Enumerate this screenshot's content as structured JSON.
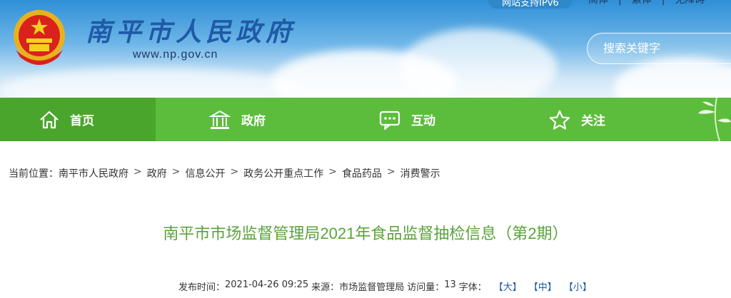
{
  "header": {
    "site_title": "南平市人民政府",
    "site_url": "www.np.gov.cn",
    "ipv6_badge": "网站支持IPv6",
    "lang_links": [
      "简体",
      "繁体",
      "无障碍"
    ],
    "search_placeholder": "搜索关键字"
  },
  "nav": {
    "items": [
      {
        "label": "首页",
        "icon": "home-icon",
        "active": true
      },
      {
        "label": "政府",
        "icon": "government-building-icon",
        "active": false
      },
      {
        "label": "互动",
        "icon": "chat-bubble-icon",
        "active": false
      },
      {
        "label": "关注",
        "icon": "star-icon",
        "active": false
      }
    ],
    "colors": {
      "bar": "#5cbd3c",
      "active": "#4aa52c"
    }
  },
  "breadcrumb": {
    "prefix": "当前位置：",
    "items": [
      "南平市人民政府",
      "政府",
      "信息公开",
      "政务公开重点工作",
      "食品药品",
      "消费警示"
    ],
    "separator": ">"
  },
  "article": {
    "title": "南平市市场监督管理局2021年食品监督抽检信息（第2期）",
    "publish_label": "发布时间：",
    "publish_time": "2021-04-26 09:25",
    "source_label": "来源：",
    "source": "市场监督管理局",
    "views_label": "访问量：",
    "views": "13",
    "fontsize_label": "字体：",
    "fontsize_large": "【大】",
    "fontsize_medium": "【中】",
    "fontsize_small": "【小】"
  },
  "colors": {
    "title_blue": "#1f5aa6",
    "article_title_green": "#5aa33c",
    "link_blue": "#1f5aa6"
  }
}
